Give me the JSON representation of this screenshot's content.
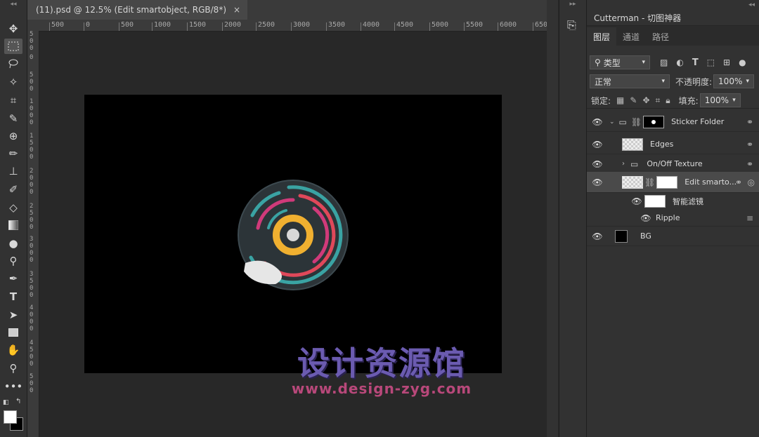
{
  "document": {
    "tab_title": "(11).psd @ 12.5% (Edit smartobject, RGB/8*)",
    "close_glyph": "×",
    "ruler_top_labels": [
      "500",
      "0",
      "500",
      "1000",
      "1500",
      "2000",
      "2500",
      "3000",
      "3500",
      "4000",
      "4500",
      "5000",
      "5500",
      "6000",
      "650"
    ],
    "ruler_left_labels": [
      "5 0 0",
      "0",
      "5 0 0",
      "1 0 0 0",
      "1 5 0 0",
      "2 0 0 0",
      "2 5 0 0",
      "3 0 0 0",
      "3 5 0 0",
      "4 0 0 0",
      "4 5 0 0",
      "5 0 0"
    ]
  },
  "watermark": {
    "title": "设计资源馆",
    "url": "www.design-zyg.com"
  },
  "right_panel": {
    "plugin_title": "Cutterman - 切图神器",
    "tabs": [
      "图层",
      "通道",
      "路径"
    ],
    "filter_label": "类型",
    "blend_mode": "正常",
    "opacity_label": "不透明度:",
    "opacity_value": "100%",
    "lock_label": "锁定:",
    "fill_label": "填充:",
    "fill_value": "100%",
    "layers": [
      {
        "name": "Sticker Folder",
        "type": "group"
      },
      {
        "name": "Edges",
        "type": "layer"
      },
      {
        "name": "On/Off Texture",
        "type": "group"
      },
      {
        "name": "Edit smarto...",
        "type": "smart"
      },
      {
        "name": "智能滤镜",
        "type": "filter-mask"
      },
      {
        "name": "Ripple",
        "type": "filter"
      },
      {
        "name": "BG",
        "type": "layer"
      }
    ]
  },
  "colors": {
    "artboard": "#000000",
    "sticker_teal": "#3aa3a3",
    "sticker_red": "#e0485a",
    "sticker_pink": "#d03a7a",
    "sticker_yellow": "#f0b030",
    "arrow": "#e02020"
  }
}
